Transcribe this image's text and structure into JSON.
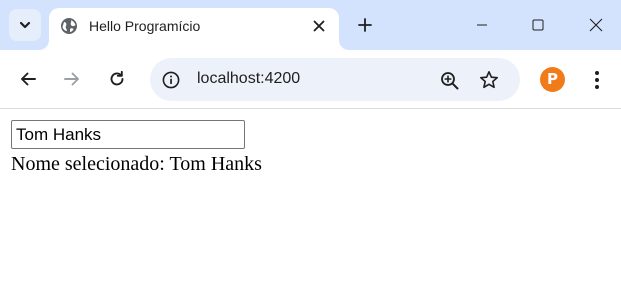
{
  "browser": {
    "tab": {
      "title": "Hello Programício",
      "favicon": "globe-icon"
    },
    "window_controls": [
      "minimize-icon",
      "maximize-icon",
      "close-icon"
    ],
    "address_bar": {
      "url": "localhost:4200",
      "site_info_icon": "info-icon"
    },
    "profile": {
      "letter": "P",
      "color": "#f27b19"
    },
    "colors": {
      "tabstrip": "#d3e3fd",
      "omnibox": "#edf1f9"
    }
  },
  "page": {
    "name_input": {
      "value": "Tom Hanks"
    },
    "selected": {
      "label": "Nome selecionado:",
      "value": "Tom Hanks"
    }
  }
}
